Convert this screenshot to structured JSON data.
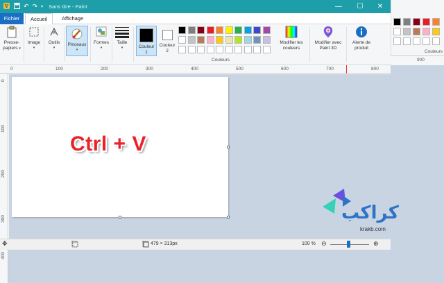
{
  "window": {
    "title": "Sans titre - Paint",
    "controls": {
      "minimize": "—",
      "maximize": "☐",
      "close": "✕"
    }
  },
  "tabs": [
    {
      "label": "Fichier"
    },
    {
      "label": "Accueil"
    },
    {
      "label": "Affichage"
    }
  ],
  "ribbon": {
    "clipboard": {
      "label": "Presse-",
      "label2": "papiers"
    },
    "image": {
      "label": "Image"
    },
    "tools": {
      "label": "Outils"
    },
    "brushes": {
      "label": "Pinceaux"
    },
    "shapes": {
      "label": "Formes"
    },
    "size": {
      "label": "Taille"
    },
    "color1": {
      "label": "Couleur",
      "label2": "1"
    },
    "color2": {
      "label": "Couleur",
      "label2": "2"
    },
    "edit_colors": {
      "label": "Modifier les",
      "label2": "couleurs"
    },
    "paint3d": {
      "label": "Modifier avec",
      "label2": "Paint 3D"
    },
    "alert": {
      "label": "Alerte de",
      "label2": "produit"
    },
    "colors_group_label": "Couleurs",
    "colors_group_label_right": "Couleurs"
  },
  "palette": {
    "row1": [
      "#000000",
      "#7f7f7f",
      "#880015",
      "#ed1c24",
      "#ff7f27",
      "#fff200",
      "#22b14c",
      "#00a2e8",
      "#3f48cc",
      "#a349a4"
    ],
    "row2": [
      "#ffffff",
      "#c3c3c3",
      "#b97a57",
      "#ffaec9",
      "#ffc90e",
      "#efe4b0",
      "#b5e61d",
      "#99d9ea",
      "#7092be",
      "#c8bfe7"
    ],
    "row3": [
      "#ffffff",
      "#ffffff",
      "#ffffff",
      "#ffffff",
      "#ffffff",
      "#ffffff",
      "#ffffff",
      "#ffffff",
      "#ffffff",
      "#ffffff"
    ],
    "right_row1": [
      "#000000",
      "#7f7f7f",
      "#880015",
      "#ed1c24",
      "#ff7f27"
    ],
    "right_row2": [
      "#ffffff",
      "#c3c3c3",
      "#b97a57",
      "#ffaec9",
      "#ffc90e"
    ],
    "right_row3": [
      "#ffffff",
      "#ffffff",
      "#ffffff",
      "#ffffff",
      "#ffffff"
    ]
  },
  "ruler": {
    "top": [
      "0",
      "100",
      "200",
      "300",
      "400",
      "500",
      "600",
      "700",
      "800"
    ],
    "left": [
      "0",
      "100",
      "200",
      "300"
    ],
    "right": "900",
    "below_left": "400"
  },
  "canvas": {
    "text": "Ctrl + V",
    "text_color": "#e8232b"
  },
  "status": {
    "dimensions": "479 × 313px",
    "zoom": "100 %"
  },
  "logo": {
    "arabic": "كراكب",
    "domain": "krakb.com"
  },
  "colors": {
    "titlebar": "#1e9ea8",
    "file_tab": "#1a6fc4",
    "workspace": "#c9d4e3"
  }
}
